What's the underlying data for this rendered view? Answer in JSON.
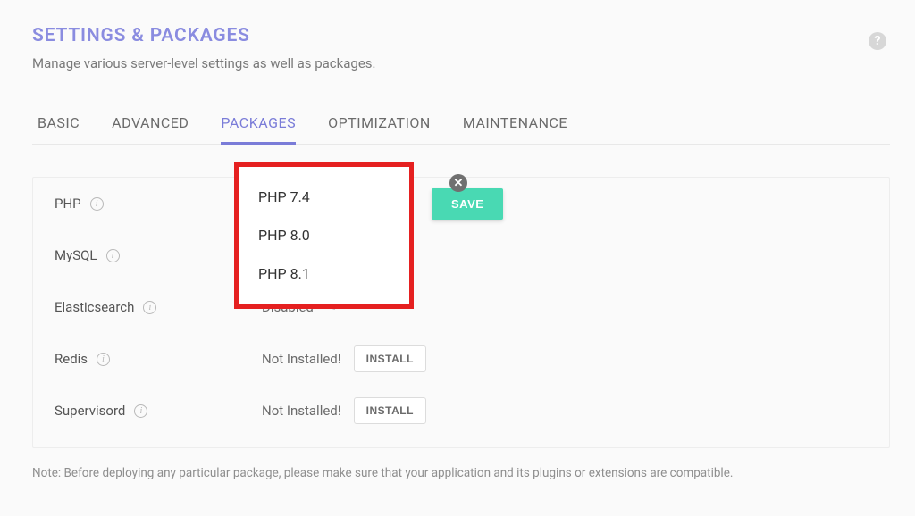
{
  "header": {
    "title": "SETTINGS & PACKAGES",
    "subtitle": "Manage various server-level settings as well as packages."
  },
  "tabs": [
    {
      "label": "BASIC"
    },
    {
      "label": "ADVANCED"
    },
    {
      "label": "PACKAGES"
    },
    {
      "label": "OPTIMIZATION"
    },
    {
      "label": "MAINTENANCE"
    }
  ],
  "dropdown": {
    "options": [
      {
        "label": "PHP 7.4"
      },
      {
        "label": "PHP 8.0"
      },
      {
        "label": "PHP 8.1"
      }
    ]
  },
  "rows": {
    "php": {
      "label": "PHP",
      "save_label": "SAVE"
    },
    "mysql": {
      "label": "MySQL"
    },
    "elasticsearch": {
      "label": "Elasticsearch",
      "value": "Disabled"
    },
    "redis": {
      "label": "Redis",
      "value": "Not Installed!",
      "install_label": "INSTALL"
    },
    "supervisord": {
      "label": "Supervisord",
      "value": "Not Installed!",
      "install_label": "INSTALL"
    }
  },
  "footer": {
    "note": "Note: Before deploying any particular package, please make sure that your application and its plugins or extensions are compatible."
  }
}
